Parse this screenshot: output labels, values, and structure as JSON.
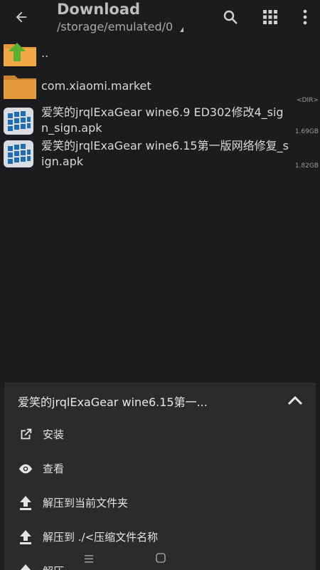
{
  "toolbar": {
    "title": "Download",
    "path": "/storage/emulated/0",
    "icons": [
      "back-arrow-icon",
      "search-icon",
      "grid-view-icon",
      "more-vert-icon"
    ]
  },
  "files": [
    {
      "name": "..",
      "meta": "",
      "icon": "parent-folder-icon"
    },
    {
      "name": "com.xiaomi.market",
      "meta": "<DIR>",
      "icon": "folder-icon"
    },
    {
      "name": "爱笑的jrqlExaGear wine6.9 ED302修改4_sign_sign.apk",
      "meta": "1.69GB",
      "icon": "apk-icon"
    },
    {
      "name": "爱笑的jrqlExaGear wine6.15第一版网络修复_sign.apk",
      "meta": "1.82GB",
      "icon": "apk-icon"
    }
  ],
  "sheet": {
    "title": "爱笑的jrqlExaGear wine6.15第一...",
    "actions": [
      {
        "label": "安装",
        "icon": "open-external-icon"
      },
      {
        "label": "查看",
        "icon": "eye-icon"
      },
      {
        "label": "解压到当前文件夹",
        "icon": "upload-icon"
      },
      {
        "label": "解压到 ./<压缩文件名称",
        "icon": "upload-icon"
      },
      {
        "label": "解压",
        "icon": "upload-icon"
      }
    ]
  },
  "colors": {
    "background": "#1c1c1e",
    "sheet": "#2b2b2d",
    "folder": "#e39a3a",
    "parent_arrow": "#4caf50"
  }
}
